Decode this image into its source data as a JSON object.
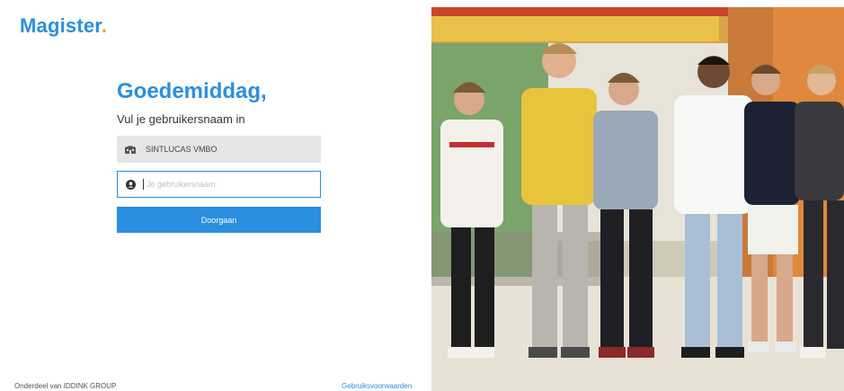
{
  "brand": {
    "name": "Magister",
    "dot": "."
  },
  "login": {
    "greeting": "Goedemiddag,",
    "subtitle": "Vul je gebruikersnaam in",
    "school": "SINTLUCAS VMBO",
    "username_placeholder": "Je gebruikersnaam",
    "username_value": "",
    "continue_label": "Doorgaan"
  },
  "footer": {
    "left": "Onderdeel van IDDINK GROUP",
    "right": "Gebruiksvoorwaarden"
  },
  "colors": {
    "accent": "#2a8fe0",
    "brand_dot": "#f5a623",
    "school_bg": "#e6e6e6"
  },
  "icons": {
    "school": "school-building-icon",
    "user": "user-icon"
  }
}
